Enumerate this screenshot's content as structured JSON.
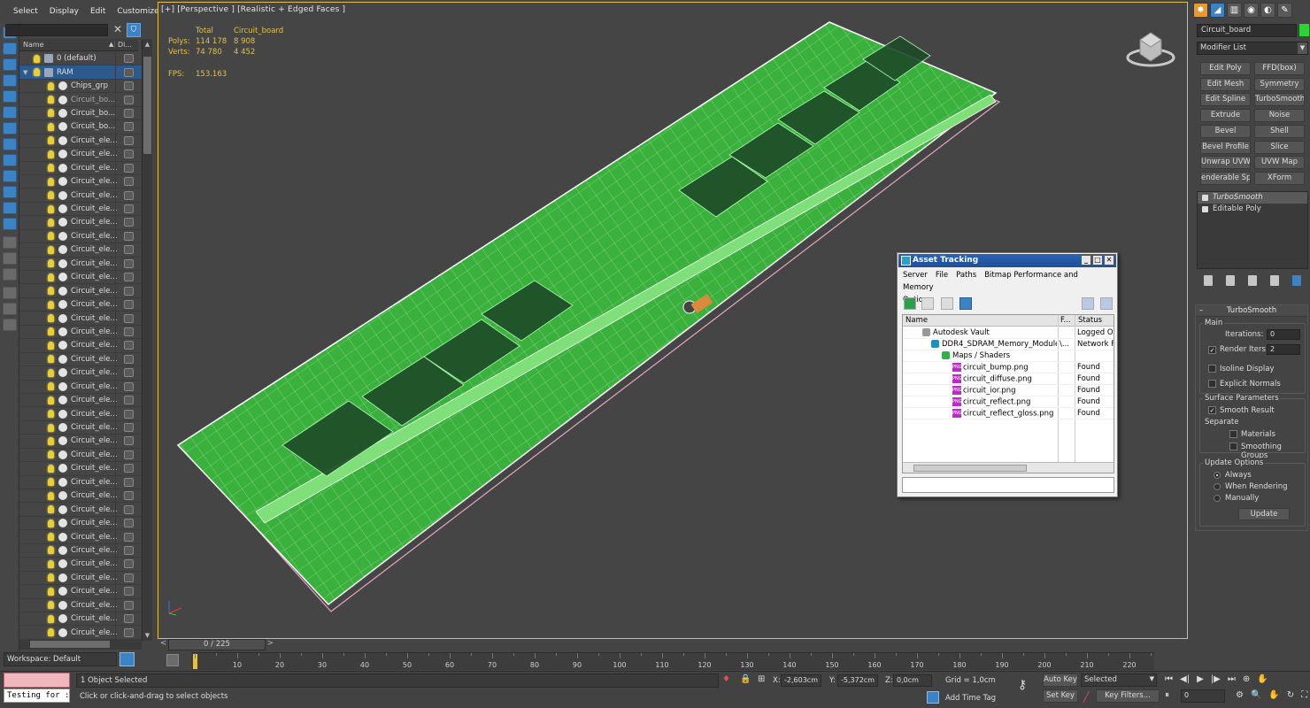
{
  "menu": {
    "items": [
      "Select",
      "Display",
      "Edit",
      "Customize"
    ]
  },
  "scene_explorer": {
    "col_name": "Name",
    "col_display": "Di...",
    "rows": [
      {
        "label": "0 (default)",
        "indent": 1,
        "type": "layer"
      },
      {
        "label": "RAM",
        "indent": 1,
        "type": "layer",
        "selected": true
      },
      {
        "label": "Chips_grp",
        "indent": 2,
        "type": "obj"
      },
      {
        "label": "Circuit_bo...",
        "indent": 2,
        "type": "obj",
        "dim": true
      },
      {
        "label": "Circuit_bo...",
        "indent": 2,
        "type": "obj"
      },
      {
        "label": "Circuit_bo...",
        "indent": 2,
        "type": "obj"
      },
      {
        "label": "Circuit_ele...",
        "indent": 2,
        "type": "obj"
      },
      {
        "label": "Circuit_ele...",
        "indent": 2,
        "type": "obj"
      },
      {
        "label": "Circuit_ele...",
        "indent": 2,
        "type": "obj"
      },
      {
        "label": "Circuit_ele...",
        "indent": 2,
        "type": "obj"
      },
      {
        "label": "Circuit_ele...",
        "indent": 2,
        "type": "obj"
      },
      {
        "label": "Circuit_ele...",
        "indent": 2,
        "type": "obj"
      },
      {
        "label": "Circuit_ele...",
        "indent": 2,
        "type": "obj"
      },
      {
        "label": "Circuit_ele...",
        "indent": 2,
        "type": "obj"
      },
      {
        "label": "Circuit_ele...",
        "indent": 2,
        "type": "obj"
      },
      {
        "label": "Circuit_ele...",
        "indent": 2,
        "type": "obj"
      },
      {
        "label": "Circuit_ele...",
        "indent": 2,
        "type": "obj"
      },
      {
        "label": "Circuit_ele...",
        "indent": 2,
        "type": "obj"
      },
      {
        "label": "Circuit_ele...",
        "indent": 2,
        "type": "obj"
      },
      {
        "label": "Circuit_ele...",
        "indent": 2,
        "type": "obj"
      },
      {
        "label": "Circuit_ele...",
        "indent": 2,
        "type": "obj"
      },
      {
        "label": "Circuit_ele...",
        "indent": 2,
        "type": "obj"
      },
      {
        "label": "Circuit_ele...",
        "indent": 2,
        "type": "obj"
      },
      {
        "label": "Circuit_ele...",
        "indent": 2,
        "type": "obj"
      },
      {
        "label": "Circuit_ele...",
        "indent": 2,
        "type": "obj"
      },
      {
        "label": "Circuit_ele...",
        "indent": 2,
        "type": "obj"
      },
      {
        "label": "Circuit_ele...",
        "indent": 2,
        "type": "obj"
      },
      {
        "label": "Circuit_ele...",
        "indent": 2,
        "type": "obj"
      },
      {
        "label": "Circuit_ele...",
        "indent": 2,
        "type": "obj"
      },
      {
        "label": "Circuit_ele...",
        "indent": 2,
        "type": "obj"
      },
      {
        "label": "Circuit_ele...",
        "indent": 2,
        "type": "obj"
      },
      {
        "label": "Circuit_ele...",
        "indent": 2,
        "type": "obj"
      },
      {
        "label": "Circuit_ele...",
        "indent": 2,
        "type": "obj"
      },
      {
        "label": "Circuit_ele...",
        "indent": 2,
        "type": "obj"
      },
      {
        "label": "Circuit_ele...",
        "indent": 2,
        "type": "obj"
      },
      {
        "label": "Circuit_ele...",
        "indent": 2,
        "type": "obj"
      },
      {
        "label": "Circuit_ele...",
        "indent": 2,
        "type": "obj"
      },
      {
        "label": "Circuit_ele...",
        "indent": 2,
        "type": "obj"
      },
      {
        "label": "Circuit_ele...",
        "indent": 2,
        "type": "obj"
      },
      {
        "label": "Circuit_ele...",
        "indent": 2,
        "type": "obj"
      },
      {
        "label": "Circuit_ele...",
        "indent": 2,
        "type": "obj"
      },
      {
        "label": "Circuit_ele...",
        "indent": 2,
        "type": "obj"
      },
      {
        "label": "Circuit_ele...",
        "indent": 2,
        "type": "obj"
      }
    ]
  },
  "workspace": {
    "label": "Workspace: Default"
  },
  "viewport": {
    "label": "[+] [Perspective ] [Realistic + Edged Faces ]",
    "stats": {
      "total_label": "Total",
      "object_label": "Circuit_board",
      "polys_label": "Polys:",
      "polys_total": "114 178",
      "polys_obj": "8 908",
      "verts_label": "Verts:",
      "verts_total": "74 780",
      "verts_obj": "4 452",
      "fps_label": "FPS:",
      "fps_value": "153.163"
    }
  },
  "time_slider": {
    "label": "0 / 225"
  },
  "timeline": {
    "ticks": [
      0,
      10,
      20,
      30,
      40,
      50,
      60,
      70,
      80,
      90,
      100,
      110,
      120,
      130,
      140,
      150,
      160,
      170,
      180,
      190,
      200,
      210,
      220
    ],
    "labels": [
      "10",
      "20",
      "30",
      "40",
      "50",
      "60",
      "70",
      "80",
      "90",
      "100",
      "110",
      "120",
      "130",
      "140",
      "150",
      "160",
      "170",
      "180",
      "190",
      "200",
      "210",
      "220"
    ]
  },
  "asset_tracking": {
    "title": "Asset Tracking",
    "menu1": [
      "Server",
      "File",
      "Paths",
      "Bitmap Performance and Memory"
    ],
    "menu2": [
      "Options"
    ],
    "col_name": "Name",
    "col_f": "F...",
    "col_status": "Status",
    "rows": [
      {
        "name": "Autodesk Vault",
        "status": "Logged Ou",
        "indent": 1,
        "f": ""
      },
      {
        "name": "DDR4_SDRAM_Memory_Module...",
        "status": "Network Pa",
        "indent": 2,
        "f": "\\..."
      },
      {
        "name": "Maps / Shaders",
        "status": "",
        "indent": 3,
        "f": ""
      },
      {
        "name": "circuit_bump.png",
        "status": "Found",
        "indent": 4,
        "f": ""
      },
      {
        "name": "circuit_diffuse.png",
        "status": "Found",
        "indent": 4,
        "f": ""
      },
      {
        "name": "circuit_ior.png",
        "status": "Found",
        "indent": 4,
        "f": ""
      },
      {
        "name": "circuit_reflect.png",
        "status": "Found",
        "indent": 4,
        "f": ""
      },
      {
        "name": "circuit_reflect_gloss.png",
        "status": "Found",
        "indent": 4,
        "f": ""
      }
    ],
    "png_badge": "PNG"
  },
  "command_panel": {
    "object_name": "Circuit_board",
    "object_color": "#29d433",
    "modifier_list": "Modifier List",
    "buttons": [
      [
        "Edit Poly",
        "FFD(box)"
      ],
      [
        "Edit Mesh",
        "Symmetry"
      ],
      [
        "Edit Spline",
        "TurboSmooth"
      ],
      [
        "Extrude",
        "Noise"
      ],
      [
        "Bevel",
        "Shell"
      ],
      [
        "Bevel Profile",
        "Slice"
      ],
      [
        "Unwrap UVW",
        "UVW Map"
      ],
      [
        "enderable Splin",
        "XForm"
      ]
    ],
    "stack": [
      "TurboSmooth",
      "Editable Poly"
    ],
    "turbosmooth": {
      "title": "TurboSmooth",
      "main_label": "Main",
      "iterations_label": "Iterations:",
      "iterations_value": "0",
      "render_iters_label": "Render Iters:",
      "render_iters_value": "2",
      "isoline_label": "Isoline Display",
      "explicit_label": "Explicit Normals",
      "surface_label": "Surface Parameters",
      "smooth_result_label": "Smooth Result",
      "separate_label": "Separate",
      "materials_label": "Materials",
      "smoothing_groups_label": "Smoothing Groups",
      "update_options_label": "Update Options",
      "always_label": "Always",
      "when_rendering_label": "When Rendering",
      "manually_label": "Manually",
      "update_button": "Update"
    }
  },
  "status_bar": {
    "maxscript_input": "Testing for :",
    "selection_status": "1 Object Selected",
    "prompt": "Click or click-and-drag to select objects",
    "x_label": "X:",
    "x_value": "-2,603cm",
    "y_label": "Y:",
    "y_value": "-5,372cm",
    "z_label": "Z:",
    "z_value": "0,0cm",
    "grid": "Grid = 1,0cm",
    "add_time_tag": "Add Time Tag",
    "auto_key": "Auto Key",
    "set_key": "Set Key",
    "selected_dropdown": "Selected",
    "key_filters": "Key Filters...",
    "frame_value": "0"
  }
}
